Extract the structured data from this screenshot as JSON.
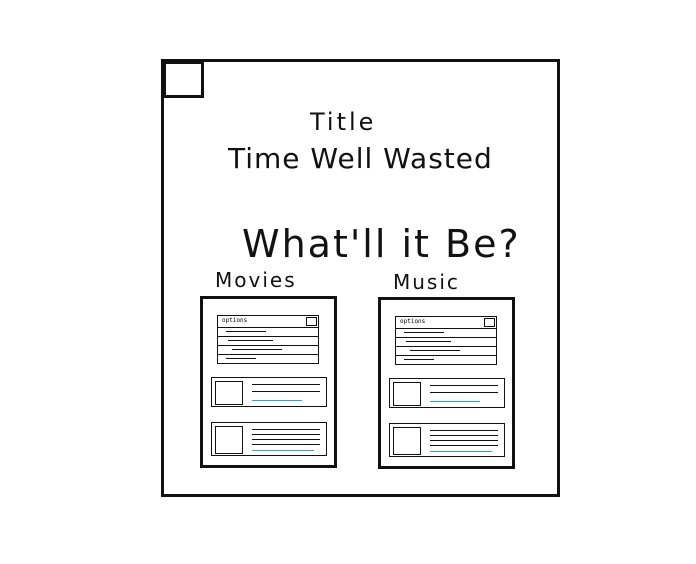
{
  "sketch": {
    "heading": "Title",
    "subtitle": "Time Well Wasted",
    "question": "What'll it Be?",
    "sections": [
      {
        "label": "Movies",
        "options_label": "options"
      },
      {
        "label": "Music",
        "options_label": "options"
      }
    ]
  },
  "colors": {
    "ink": "#111111",
    "link_line": "#29a3e0",
    "background": "#ffffff"
  },
  "icons": {
    "corner": "square-icon",
    "thumbnail": "image-placeholder-icon"
  }
}
